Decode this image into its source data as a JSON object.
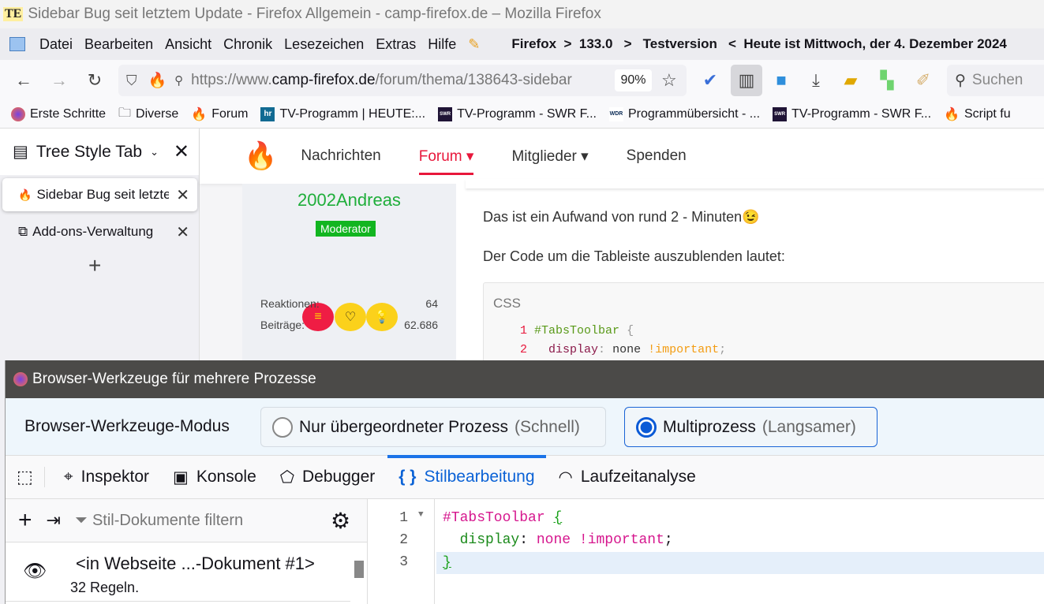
{
  "window": {
    "title": "Sidebar Bug seit letztem Update - Firefox Allgemein - camp-firefox.de – Mozilla Firefox",
    "title_icon_text": "TE"
  },
  "menu": {
    "items": [
      "Datei",
      "Bearbeiten",
      "Ansicht",
      "Chronik",
      "Lesezeichen",
      "Extras",
      "Hilfe"
    ],
    "info": "Firefox  >  133.0   >   Testversion   <  Heute ist Mittwoch, der 4. Dezember 2024"
  },
  "nav": {
    "url_prefix": "https://www.",
    "url_host": "camp-firefox.de",
    "url_path": "/forum/thema/138643-sidebar",
    "zoom": "90%",
    "search_placeholder": "Suchen"
  },
  "bookmarks": [
    {
      "label": "Erste Schritte",
      "icon": "firefox-icon"
    },
    {
      "label": "Diverse",
      "icon": "folder-icon"
    },
    {
      "label": "Forum",
      "icon": "flame-icon"
    },
    {
      "label": "TV-Programm | HEUTE:...",
      "icon": "hr-icon",
      "icon_text": "hr"
    },
    {
      "label": "TV-Programm - SWR F...",
      "icon": "swr-icon",
      "icon_text": "SWR"
    },
    {
      "label": "Programmübersicht - ...",
      "icon": "wdr-icon",
      "icon_text": "WDR"
    },
    {
      "label": "TV-Programm - SWR F...",
      "icon": "swr-icon",
      "icon_text": "SWR"
    },
    {
      "label": "Script fu",
      "icon": "flame-icon"
    }
  ],
  "sidebar": {
    "title": "Tree Style Tab",
    "tabs": [
      {
        "label": "Sidebar Bug seit letztem Update",
        "selected": true
      },
      {
        "label": "Add-ons-Verwaltung",
        "selected": false
      }
    ]
  },
  "site": {
    "nav": [
      "Nachrichten",
      "Forum",
      "Mitglieder",
      "Spenden"
    ],
    "active": "Forum",
    "profile": {
      "name": "2002Andreas",
      "role": "Moderator",
      "stats": [
        {
          "label": "Reaktionen:",
          "value": "64"
        },
        {
          "label": "Beiträge:",
          "value": "62.686"
        }
      ]
    },
    "post": {
      "line1": "Das ist ein Aufwand von rund 2 - Minuten",
      "line2": "Der Code um die Tableiste auszublenden lautet:",
      "code_lang": "CSS",
      "code": [
        {
          "n": "1",
          "sel": "#TabsToolbar",
          "brace": "{"
        },
        {
          "n": "2",
          "prop": "display",
          "val": "none",
          "imp": "!important"
        }
      ]
    }
  },
  "devtools": {
    "title": "Browser-Werkzeuge für mehrere Prozesse",
    "mode_label": "Browser-Werkzeuge-Modus",
    "modes": [
      {
        "label": "Nur übergeordneter Prozess",
        "hint": "(Schnell)",
        "selected": false
      },
      {
        "label": "Multiprozess",
        "hint": "(Langsamer)",
        "selected": true
      }
    ],
    "tabs": [
      "Inspektor",
      "Konsole",
      "Debugger",
      "Stilbearbeitung",
      "Laufzeitanalyse"
    ],
    "active_tab": "Stilbearbeitung",
    "filter_placeholder": "Stil-Dokumente filtern",
    "sheet": {
      "name": "<in Webseite ...-Dokument #1>",
      "rules": "32 Regeln."
    },
    "editor": {
      "lines": [
        "1",
        "2",
        "3"
      ],
      "selector": "#TabsToolbar",
      "open": "{",
      "prop": "display",
      "colon": ":",
      "val": "none",
      "imp": "!important",
      "semi": ";",
      "close": "}"
    }
  }
}
